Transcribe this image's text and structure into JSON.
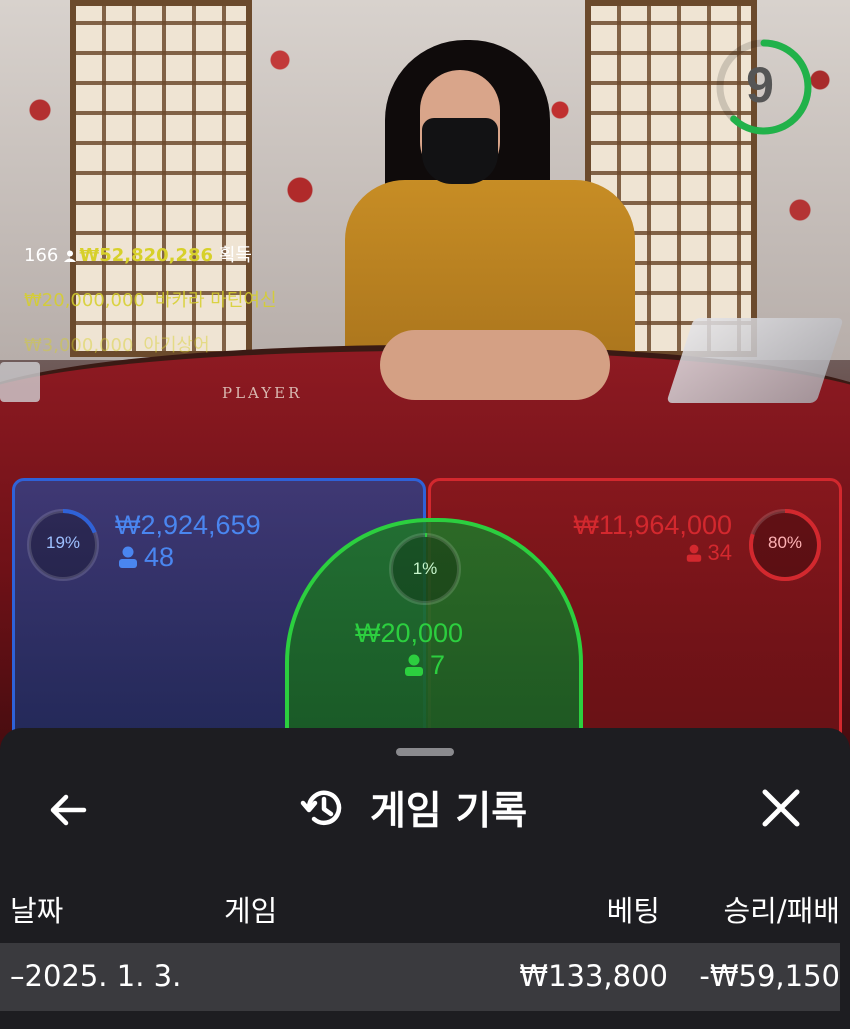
{
  "timer": {
    "value": "9",
    "color": "#21b24a"
  },
  "table": {
    "player_print": "PLAYER"
  },
  "winners": [
    {
      "count": "166",
      "total": "₩52,820,286",
      "suffix": "획득"
    },
    {
      "amount": "₩20,000,000",
      "name": "바카라 마틴여신"
    },
    {
      "amount": "₩3,000,000",
      "name": "아기상어"
    }
  ],
  "bets": {
    "player": {
      "percent": "19%",
      "percent_value": 0.19,
      "amount": "₩2,924,659",
      "players": "48",
      "color": "#2f62d8"
    },
    "tie": {
      "percent": "1%",
      "percent_value": 0.01,
      "amount": "₩20,000",
      "players": "7",
      "color": "#2ccf3f"
    },
    "banker": {
      "percent": "80%",
      "percent_value": 0.8,
      "amount": "₩11,964,000",
      "players": "34",
      "color": "#d3282e"
    }
  },
  "history": {
    "title": "게임 기록",
    "columns": {
      "date": "날짜",
      "game": "게임",
      "bet": "베팅",
      "win_loss": "승리/패배"
    },
    "rows": [
      {
        "date": "–2025. 1. 3.",
        "game": "",
        "bet": "₩133,800",
        "win_loss": "-₩59,150"
      }
    ]
  }
}
